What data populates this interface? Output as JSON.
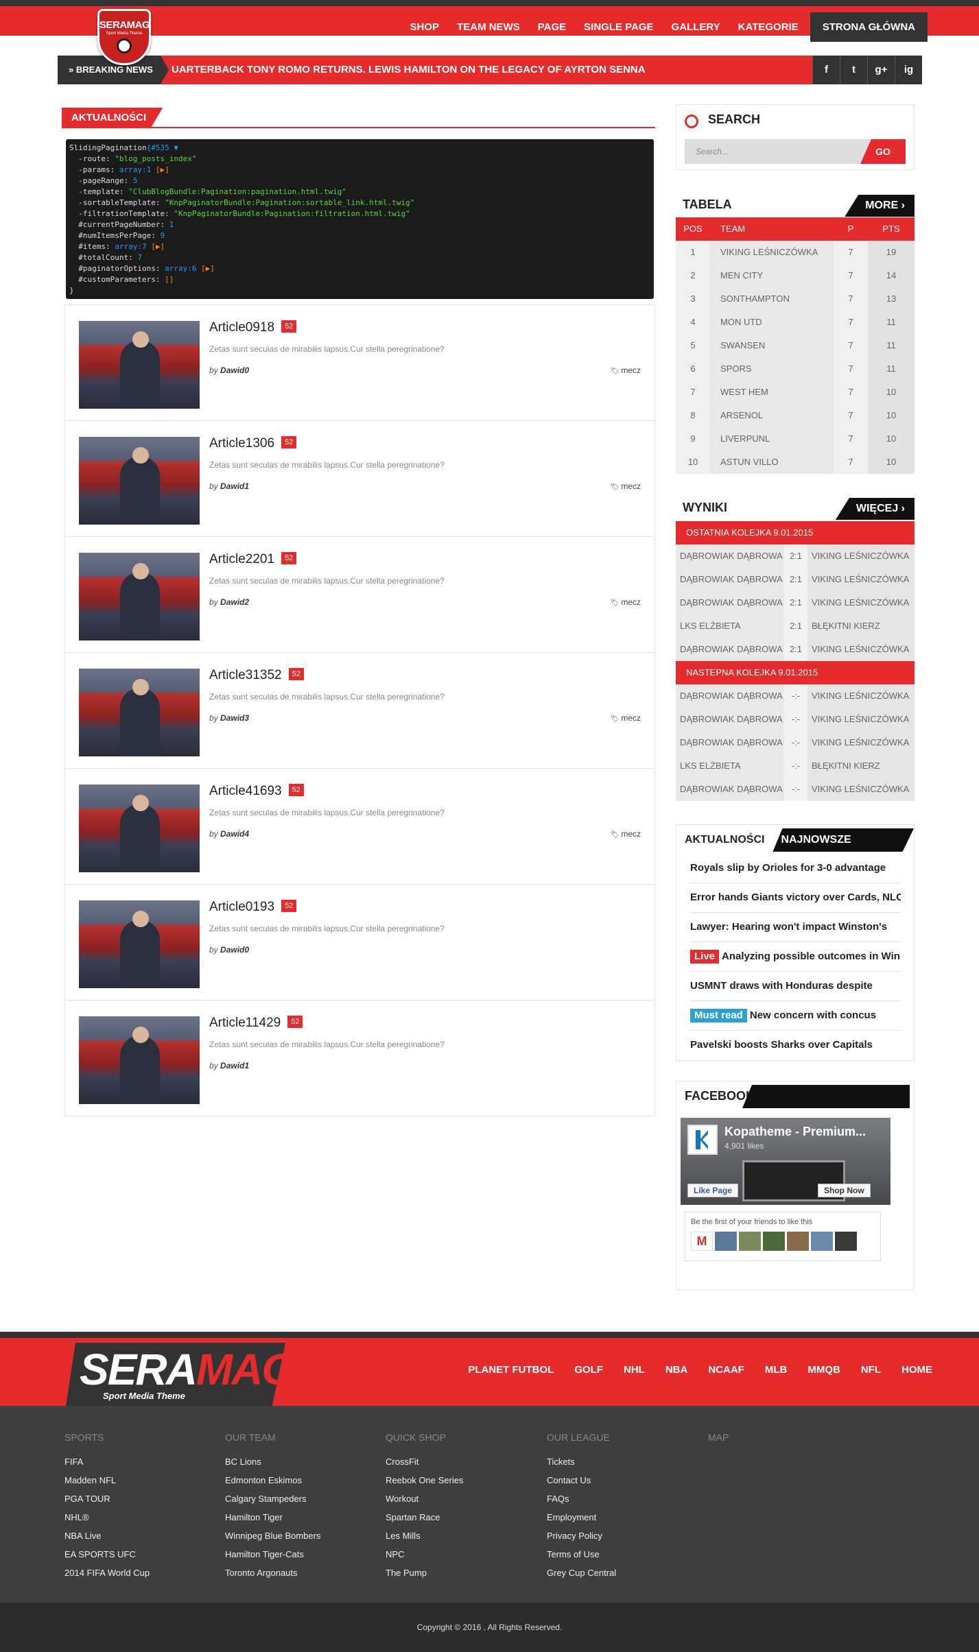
{
  "header": {
    "logo_text": "SERAMAG",
    "logo_sub": "Sport Media Theme",
    "nav": [
      "SHOP",
      "TEAM NEWS",
      "PAGE",
      "SINGLE PAGE",
      "GALLERY",
      "KATEGORIE",
      "STRONA GŁÓWNA"
    ]
  },
  "breaking": {
    "label": "BREAKING NEWS",
    "text": "UARTERBACK TONY ROMO RETURNS. LEWIS HAMILTON ON THE LEGACY OF AYRTON SENNA",
    "social": [
      "f",
      "t",
      "g+",
      "ig"
    ]
  },
  "main": {
    "heading": "AKTUALNOŚCI",
    "debug": [
      {
        "k": "SlidingPagination",
        "v": "{#535 ▼"
      },
      {
        "k": "  -route: ",
        "s": "\"blog_posts_index\""
      },
      {
        "k": "  -params: ",
        "c": "array:1",
        "o": " [▶]"
      },
      {
        "k": "  -pageRange: ",
        "c": "5"
      },
      {
        "k": "  -template: ",
        "s": "\"ClubBlogBundle:Pagination:pagination.html.twig\""
      },
      {
        "k": "  -sortableTemplate: ",
        "s": "\"KnpPaginatorBundle:Pagination:sortable_link.html.twig\""
      },
      {
        "k": "  -filtrationTemplate: ",
        "s": "\"KnpPaginatorBundle:Pagination:filtration.html.twig\""
      },
      {
        "k": "  #currentPageNumber: ",
        "c": "1"
      },
      {
        "k": "  #numItemsPerPage: ",
        "c": "9"
      },
      {
        "k": "  #items: ",
        "c": "array:7",
        "o": " [▶]"
      },
      {
        "k": "  #totalCount: ",
        "c": "7"
      },
      {
        "k": "  #paginatorOptions: ",
        "c": "array:6",
        "o": " [▶]"
      },
      {
        "k": "  #customParameters: ",
        "o": "[]"
      },
      {
        "k": "}"
      }
    ],
    "articles": [
      {
        "title": "Article0918",
        "count": "52",
        "desc": "Zetas sunt seculas de mirabilis lapsus.Cur stella peregrinatione?",
        "by": "by",
        "author": "Dawid0",
        "tag": "mecz"
      },
      {
        "title": "Article1306",
        "count": "52",
        "desc": "Zetas sunt seculas de mirabilis lapsus.Cur stella peregrinatione?",
        "by": "by",
        "author": "Dawid1",
        "tag": "mecz"
      },
      {
        "title": "Article2201",
        "count": "52",
        "desc": "Zetas sunt seculas de mirabilis lapsus.Cur stella peregrinatione?",
        "by": "by",
        "author": "Dawid2",
        "tag": "mecz"
      },
      {
        "title": "Article31352",
        "count": "52",
        "desc": "Zetas sunt seculas de mirabilis lapsus.Cur stella peregrinatione?",
        "by": "by",
        "author": "Dawid3",
        "tag": "mecz"
      },
      {
        "title": "Article41693",
        "count": "52",
        "desc": "Zetas sunt seculas de mirabilis lapsus.Cur stella peregrinatione?",
        "by": "by",
        "author": "Dawid4",
        "tag": "mecz"
      },
      {
        "title": "Article0193",
        "count": "52",
        "desc": "Zetas sunt seculas de mirabilis lapsus.Cur stella peregrinatione?",
        "by": "by",
        "author": "Dawid0",
        "tag": ""
      },
      {
        "title": "Article11429",
        "count": "52",
        "desc": "Zetas sunt seculas de mirabilis lapsus.Cur stella peregrinatione?",
        "by": "by",
        "author": "Dawid1",
        "tag": ""
      }
    ]
  },
  "sidebar": {
    "search": {
      "title": "SEARCH",
      "placeholder": "Search...",
      "button": "GO"
    },
    "table": {
      "title": "TABELA",
      "more": "MORE",
      "headers": [
        "POS",
        "TEAM",
        "P",
        "PTS"
      ],
      "rows": [
        [
          "1",
          "VIKING LEŚNICZÓWKA",
          "7",
          "19"
        ],
        [
          "2",
          "MEN CITY",
          "7",
          "14"
        ],
        [
          "3",
          "SONTHAMPTON",
          "7",
          "13"
        ],
        [
          "4",
          "MON UTD",
          "7",
          "11"
        ],
        [
          "5",
          "SWANSEN",
          "7",
          "11"
        ],
        [
          "6",
          "SPORS",
          "7",
          "11"
        ],
        [
          "7",
          "WEST HEM",
          "7",
          "10"
        ],
        [
          "8",
          "ARSENOL",
          "7",
          "10"
        ],
        [
          "9",
          "LIVERPUNL",
          "7",
          "10"
        ],
        [
          "10",
          "ASTUN VILLO",
          "7",
          "10"
        ]
      ]
    },
    "results": {
      "title": "WYNIKI",
      "more": "WIĘCEJ",
      "last_label": "OSTATNIA KOLEJKA 9.01.2015",
      "last": [
        [
          "DĄBROWIAK DĄBROWA",
          "2:1",
          "VIKING LEŚNICZÓWKA"
        ],
        [
          "DĄBROWIAK DĄBROWA",
          "2:1",
          "VIKING LEŚNICZÓWKA"
        ],
        [
          "DĄBROWIAK DĄBROWA",
          "2:1",
          "VIKING LEŚNICZÓWKA"
        ],
        [
          "LKS ELŻBIETA",
          "2:1",
          "BŁĘKITNI KIERZ"
        ],
        [
          "DĄBROWIAK DĄBROWA",
          "2:1",
          "VIKING LEŚNICZÓWKA"
        ]
      ],
      "next_label": "NASTEPNA KOLEJKA 9.01.2015",
      "next": [
        [
          "DĄBROWIAK DĄBROWA",
          "-:-",
          "VIKING LEŚNICZÓWKA"
        ],
        [
          "DĄBROWIAK DĄBROWA",
          "-:-",
          "VIKING LEŚNICZÓWKA"
        ],
        [
          "DĄBROWIAK DĄBROWA",
          "-:-",
          "VIKING LEŚNICZÓWKA"
        ],
        [
          "LKS ELŻBIETA",
          "-:-",
          "BŁĘKITNI KIERZ"
        ],
        [
          "DĄBROWIAK DĄBROWA",
          "-:-",
          "VIKING LEŚNICZÓWKA"
        ]
      ]
    },
    "comments": {
      "tab1": "AKTUALNOŚCI",
      "tab2": "NAJNOWSZE KOMENTARZE",
      "items": [
        {
          "label": "",
          "text": "Royals slip by Orioles for 3-0 advantage"
        },
        {
          "label": "",
          "text": "Error hands Giants victory over Cards, NLCS"
        },
        {
          "label": "",
          "text": "Lawyer: Hearing won't impact Winston's"
        },
        {
          "label": "Live",
          "text": "Analyzing possible outcomes in Winston"
        },
        {
          "label": "",
          "text": "USMNT draws with Honduras despite"
        },
        {
          "label": "Must read",
          "text": "New concern with concus"
        },
        {
          "label": "",
          "text": "Pavelski boosts Sharks over Capitals"
        }
      ]
    },
    "facebook": {
      "title": "FACEBOOK",
      "page_name": "Kopatheme - Premium...",
      "likes": "4,901 likes",
      "like_btn": "Like Page",
      "shop_btn": "Shop Now",
      "friends_text": "Be the first of your friends to like this"
    }
  },
  "footer": {
    "logo_a": "SERA",
    "logo_b": "MAG",
    "logo_sub": "Sport Media Theme",
    "nav": [
      "PLANET FUTBOL",
      "GOLF",
      "NHL",
      "NBA",
      "NCAAF",
      "MLB",
      "MMQB",
      "NFL",
      "HOME"
    ],
    "cols": [
      {
        "h": "SPORTS",
        "links": [
          "FIFA",
          "Madden NFL",
          "PGA TOUR",
          "NHL®",
          "NBA Live",
          "EA SPORTS UFC",
          "2014 FIFA World Cup"
        ]
      },
      {
        "h": "OUR TEAM",
        "links": [
          "BC Lions",
          "Edmonton Eskimos",
          "Calgary Stampeders",
          "Hamilton Tiger",
          "Winnipeg Blue Bombers",
          "Hamilton Tiger-Cats",
          "Toronto Argonauts"
        ]
      },
      {
        "h": "QUICK SHOP",
        "links": [
          "CrossFit",
          "Reebok One Series",
          "Workout",
          "Spartan Race",
          "Les Mills",
          "NPC",
          "The Pump"
        ]
      },
      {
        "h": "OUR LEAGUE",
        "links": [
          "Tickets",
          "Contact Us",
          "FAQs",
          "Employment",
          "Privacy Policy",
          "Terms of Use",
          "Grey Cup Central"
        ]
      },
      {
        "h": "MAP",
        "links": []
      }
    ],
    "copyright": "Copyright © 2016 . All Rights Reserved."
  },
  "colors": {
    "accent": "#e52b2b",
    "dark": "#333333",
    "footer": "#3e3e3e"
  }
}
